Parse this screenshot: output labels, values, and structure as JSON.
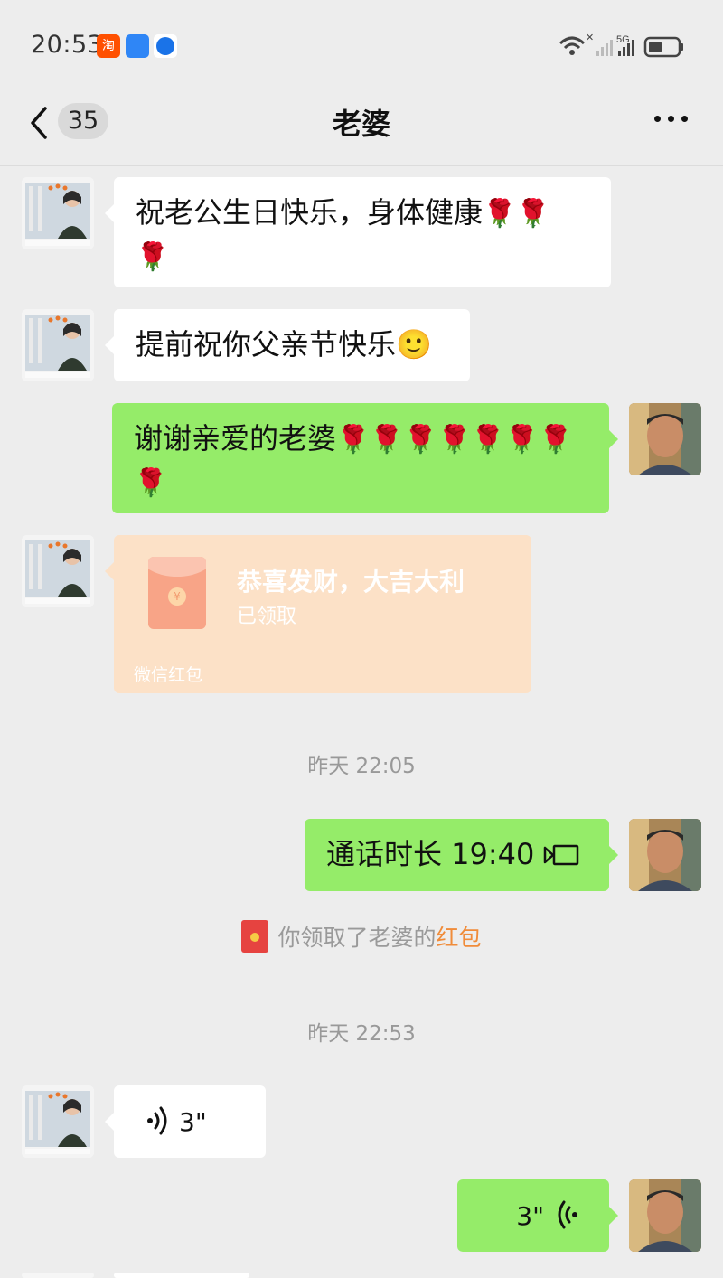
{
  "status_bar": {
    "time": "20:53",
    "apps": [
      {
        "icon": "taobao-icon",
        "label": "淘"
      },
      {
        "icon": "app-store-icon",
        "label": ""
      },
      {
        "icon": "browser-icon",
        "label": ""
      }
    ],
    "network_label": "5G",
    "battery_icon": "battery-icon",
    "wifi_icon": "wifi-icon"
  },
  "header": {
    "back_icon": "chevron-left-icon",
    "unread_count": "35",
    "title": "老婆",
    "more_icon": "more-icon"
  },
  "messages": {
    "m1": {
      "sender": "wife",
      "text": "祝老公生日快乐，身体健康",
      "emoji": "🌹",
      "emoji_count": 3
    },
    "m2": {
      "sender": "wife",
      "text": "提前祝你父亲节快乐",
      "emoji": "🙂"
    },
    "m3": {
      "sender": "me",
      "text": "谢谢亲爱的老婆",
      "emoji": "🌹",
      "emoji_count": 8
    },
    "m4": {
      "sender": "wife",
      "type": "red_packet",
      "title": "恭喜发财，大吉大利",
      "status": "已领取",
      "footer": "微信红包"
    },
    "t1": "昨天 22:05",
    "m5": {
      "sender": "me",
      "type": "call",
      "text": "通话时长 19:40",
      "icon": "video-call-icon"
    },
    "sys1": {
      "prefix": "你领取了老婆的",
      "link": "红包",
      "icon": "red-packet-icon"
    },
    "t2": "昨天 22:53",
    "m6": {
      "sender": "wife",
      "type": "voice",
      "duration": "3\"",
      "icon": "voice-wave-icon"
    },
    "m7": {
      "sender": "me",
      "type": "voice",
      "duration": "3\"",
      "icon": "voice-wave-icon"
    }
  },
  "colors": {
    "background": "#ededed",
    "self_bubble": "#95ec69",
    "other_bubble": "#ffffff",
    "red_packet_received": "#fce1c7",
    "link_orange": "#f08c3a"
  }
}
